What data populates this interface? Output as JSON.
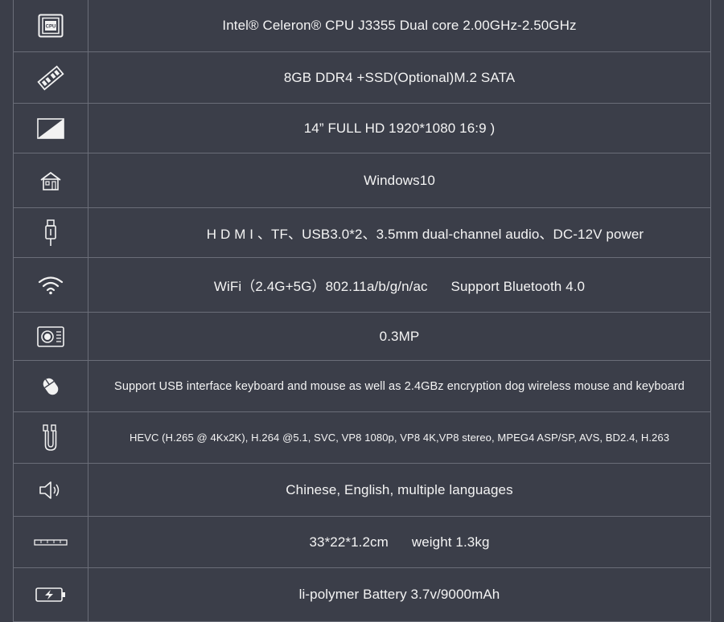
{
  "specs": [
    {
      "icon": "cpu-icon",
      "text": "Intel® Celeron®  CPU J3355   Dual core 2.00GHz-2.50GHz"
    },
    {
      "icon": "memory-icon",
      "text": "8GB  DDR4  +SSD(Optional)M.2 SATA"
    },
    {
      "icon": "display-icon",
      "text": "14”  FULL HD 1920*1080 16:9 )"
    },
    {
      "icon": "house-icon",
      "text": "Windows10"
    },
    {
      "icon": "usb-icon",
      "text": "H D M I 、TF、USB3.0*2、3.5mm dual-channel audio、DC-12V power"
    },
    {
      "icon": "wifi-icon",
      "text": "WiFi（2.4G+5G）802.11a/b/g/n/ac      Support Bluetooth 4.0"
    },
    {
      "icon": "camera-icon",
      "text": "0.3MP"
    },
    {
      "icon": "mouse-icon",
      "text": "Support USB interface keyboard and mouse as well as 2.4GBz encryption dog wireless mouse and keyboard"
    },
    {
      "icon": "cable-icon",
      "text": "HEVC (H.265 @ 4Kx2K), H.264 @5.1, SVC, VP8 1080p, VP8 4K,VP8 stereo, MPEG4 ASP/SP, AVS, BD2.4, H.263"
    },
    {
      "icon": "speaker-icon",
      "text": "Chinese, English, multiple languages"
    },
    {
      "icon": "ruler-icon",
      "text": "33*22*1.2cm      weight 1.3kg"
    },
    {
      "icon": "battery-icon",
      "text": "li-polymer Battery 3.7v/9000mAh"
    }
  ]
}
